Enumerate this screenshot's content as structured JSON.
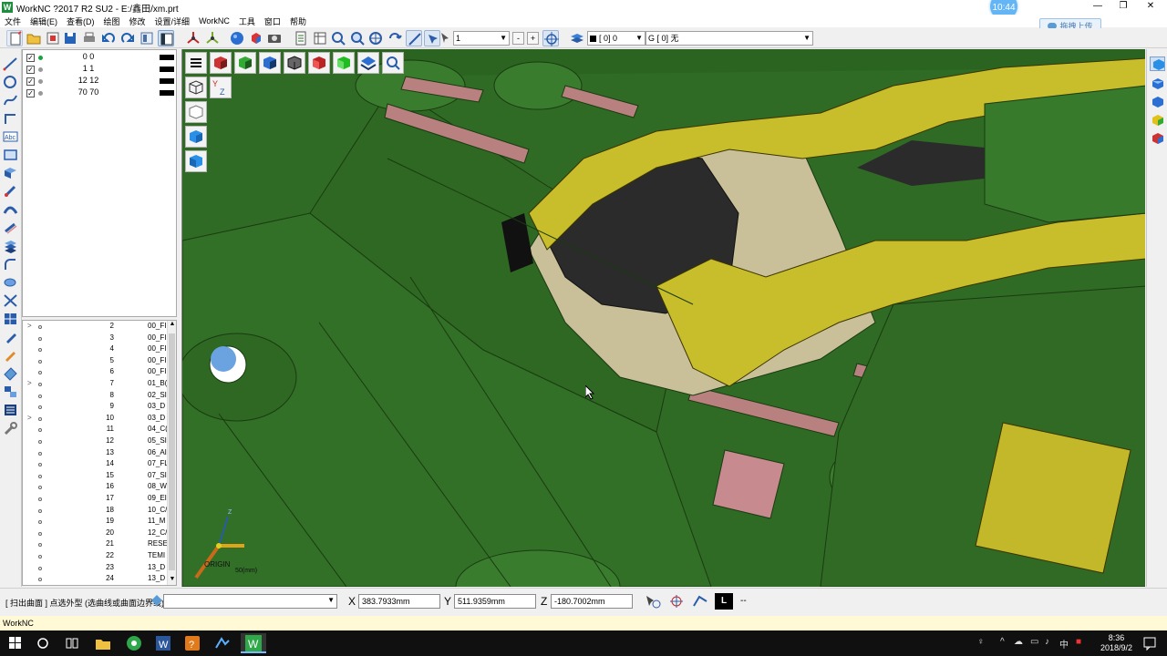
{
  "window": {
    "title": "WorkNC ?2017 R2 SU2 - E:/鑫田/xm.prt",
    "app_icon": "W",
    "clock_bubble": "10:44",
    "upload_button": "拖拽上传"
  },
  "menu": [
    "文件",
    "编辑(E)",
    "查看(D)",
    "绘图",
    "修改",
    "设置/详细",
    "WorkNC",
    "工具",
    "窗口",
    "帮助"
  ],
  "toolbar": {
    "layer_value": "1",
    "current_layer": "[ 0] 0",
    "group_label": "G [ 0] 无",
    "minus": "-",
    "plus": "+"
  },
  "layers": [
    {
      "name": "0 0",
      "checked": true,
      "active": true
    },
    {
      "name": "1 1",
      "checked": true,
      "active": false
    },
    {
      "name": "12 12",
      "checked": true,
      "active": false
    },
    {
      "name": "70 70",
      "checked": true,
      "active": false
    }
  ],
  "tree": [
    {
      "num": "2",
      "label": "00_FI",
      "expand": ">"
    },
    {
      "num": "3",
      "label": "00_FI",
      "expand": ""
    },
    {
      "num": "4",
      "label": "00_FI",
      "expand": ""
    },
    {
      "num": "5",
      "label": "00_FI",
      "expand": ""
    },
    {
      "num": "6",
      "label": "00_FI",
      "expand": ""
    },
    {
      "num": "7",
      "label": "01_B(",
      "expand": ">"
    },
    {
      "num": "8",
      "label": "02_SI",
      "expand": ""
    },
    {
      "num": "9",
      "label": "03_D",
      "expand": ""
    },
    {
      "num": "10",
      "label": "03_D",
      "expand": ">"
    },
    {
      "num": "11",
      "label": "04_C(",
      "expand": ""
    },
    {
      "num": "12",
      "label": "05_SI",
      "expand": ""
    },
    {
      "num": "13",
      "label": "06_AI",
      "expand": ""
    },
    {
      "num": "14",
      "label": "07_FL",
      "expand": ""
    },
    {
      "num": "15",
      "label": "07_SI",
      "expand": ""
    },
    {
      "num": "16",
      "label": "08_W",
      "expand": ""
    },
    {
      "num": "17",
      "label": "09_EI",
      "expand": ""
    },
    {
      "num": "18",
      "label": "10_C/",
      "expand": ""
    },
    {
      "num": "19",
      "label": "11_M",
      "expand": ""
    },
    {
      "num": "20",
      "label": "12_C/",
      "expand": ""
    },
    {
      "num": "21",
      "label": "RESE",
      "expand": ""
    },
    {
      "num": "22",
      "label": "TEMI",
      "expand": ""
    },
    {
      "num": "23",
      "label": "13_D",
      "expand": ""
    },
    {
      "num": "24",
      "label": "13_D",
      "expand": ""
    }
  ],
  "viewport": {
    "origin_label": "ORIGIN",
    "scale_label": "50(mm)",
    "axis_y": "Y",
    "axis_z": "Z"
  },
  "status": {
    "hint": "[ 扫出曲面 ] 点选外型 (选曲线或曲面边界线)",
    "x_label": "X",
    "x_value": "383.7933mm",
    "y_label": "Y",
    "y_value": "511.9359mm",
    "z_label": "Z",
    "z_value": "-180.7002mm",
    "l_button": "L",
    "dash": "--"
  },
  "app_status": "WorkNC",
  "taskbar": {
    "time": "8:36",
    "date": "2018/9/2",
    "ime": "中",
    "tray_arrow": "^"
  },
  "colors": {
    "model_green": "#2f6b24",
    "model_yellow": "#c8bd2a",
    "model_tan": "#c9c09a",
    "model_pink": "#b98080",
    "model_dark": "#2b2b2b"
  }
}
